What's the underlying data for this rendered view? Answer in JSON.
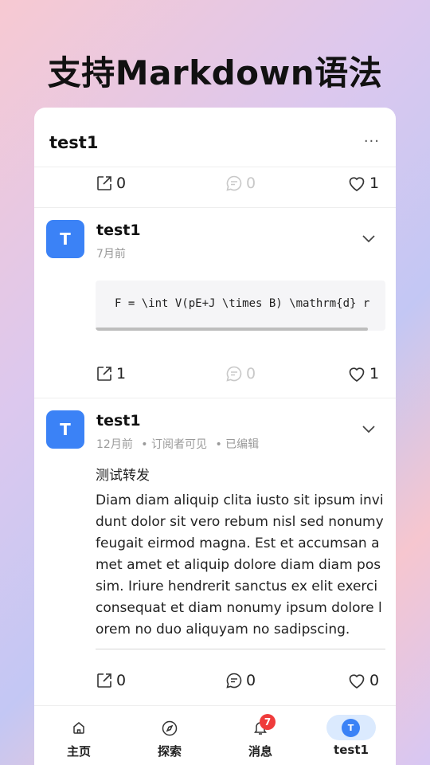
{
  "headline": "支持Markdown语法",
  "topbar": {
    "title": "test1",
    "more": "···"
  },
  "first_actions": {
    "share": "0",
    "comment": "0",
    "like": "1"
  },
  "posts": [
    {
      "avatar": "T",
      "username": "test1",
      "time": "7月前",
      "code": "F = \\int V(pE+J \\times B) \\mathrm{d} r",
      "share": "1",
      "comment": "0",
      "like": "1"
    },
    {
      "avatar": "T",
      "username": "test1",
      "time": "12月前",
      "visibility": "• 订阅者可见",
      "edited": "• 已编辑",
      "title": "测试转发",
      "body": "Diam diam aliquip clita iusto sit ipsum invidunt dolor sit vero rebum nisl sed nonumy feugait eirmod magna. Est et accumsan amet amet et aliquip dolore diam diam possim. Iriure hendrerit sanctus ex elit exerci consequat et diam nonumy ipsum dolore lorem no duo aliquyam no sadipscing.",
      "share": "0",
      "comment": "0",
      "like": "0"
    }
  ],
  "nav": {
    "home": "主页",
    "explore": "探索",
    "messages": "消息",
    "messages_badge": "7",
    "profile": "test1",
    "profile_avatar": "T"
  },
  "colors": {
    "accent": "#3b82f6",
    "badge": "#ef3b3b"
  }
}
